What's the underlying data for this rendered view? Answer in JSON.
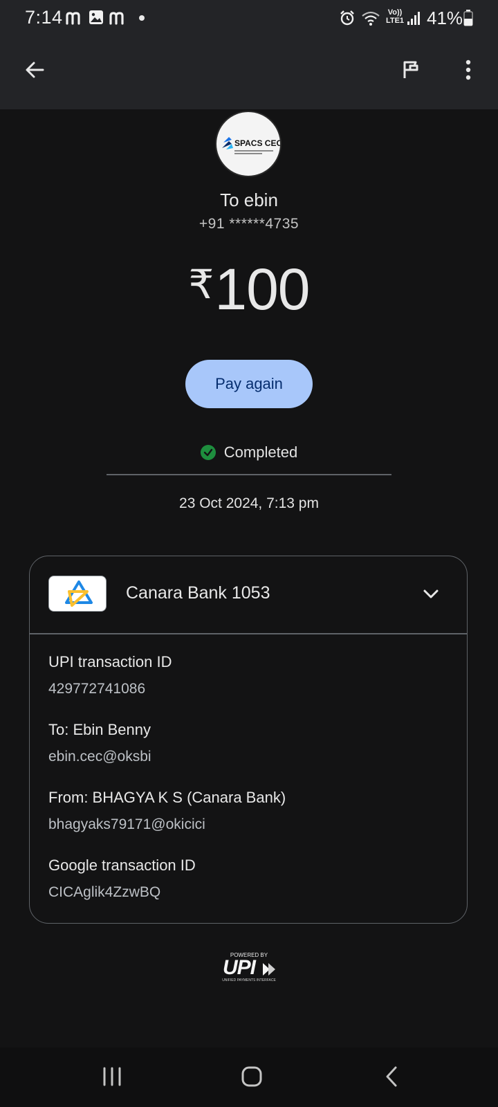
{
  "status_bar": {
    "time": "7:14",
    "battery_percent": "41%",
    "notification_icons": [
      "m-app-icon",
      "gallery-icon",
      "m-app-icon"
    ],
    "system_icons": [
      "alarm-icon",
      "wifi-icon",
      "volte-icon",
      "signal-icon",
      "battery-icon"
    ],
    "volte_line1": "Vo))",
    "volte_line2": "LTE1"
  },
  "app_bar": {
    "icons": [
      "back-arrow-icon",
      "flag-icon",
      "more-vert-icon"
    ]
  },
  "payee": {
    "avatar_text": "SPACS CEC",
    "name_line": "To ebin",
    "phone": "+91 ******4735"
  },
  "payment": {
    "currency_symbol": "₹",
    "amount": "100",
    "pay_again_label": "Pay again",
    "status": "Completed",
    "datetime": "23 Oct 2024, 7:13 pm"
  },
  "details": {
    "bank_name": "Canara Bank 1053",
    "items": [
      {
        "label": "UPI transaction ID",
        "value": "429772741086"
      },
      {
        "label": "To: Ebin  Benny",
        "value": "ebin.cec@oksbi"
      },
      {
        "label": "From: BHAGYA K S (Canara Bank)",
        "value": "bhagyaks79171@okicici"
      },
      {
        "label": "Google transaction ID",
        "value": "CICAglik4ZzwBQ"
      }
    ]
  },
  "footer": {
    "powered_by": "POWERED BY",
    "upi_text": "UPI",
    "upi_sub": "UNIFIED PAYMENTS INTERFACE"
  },
  "nav_bar": {
    "icons": [
      "recents-icon",
      "home-icon",
      "back-icon"
    ]
  },
  "colors": {
    "background": "#131314",
    "appbar": "#232427",
    "pay_again_bg": "#a8c7fa",
    "pay_again_text": "#062e6f",
    "success": "#1e8e3e"
  }
}
